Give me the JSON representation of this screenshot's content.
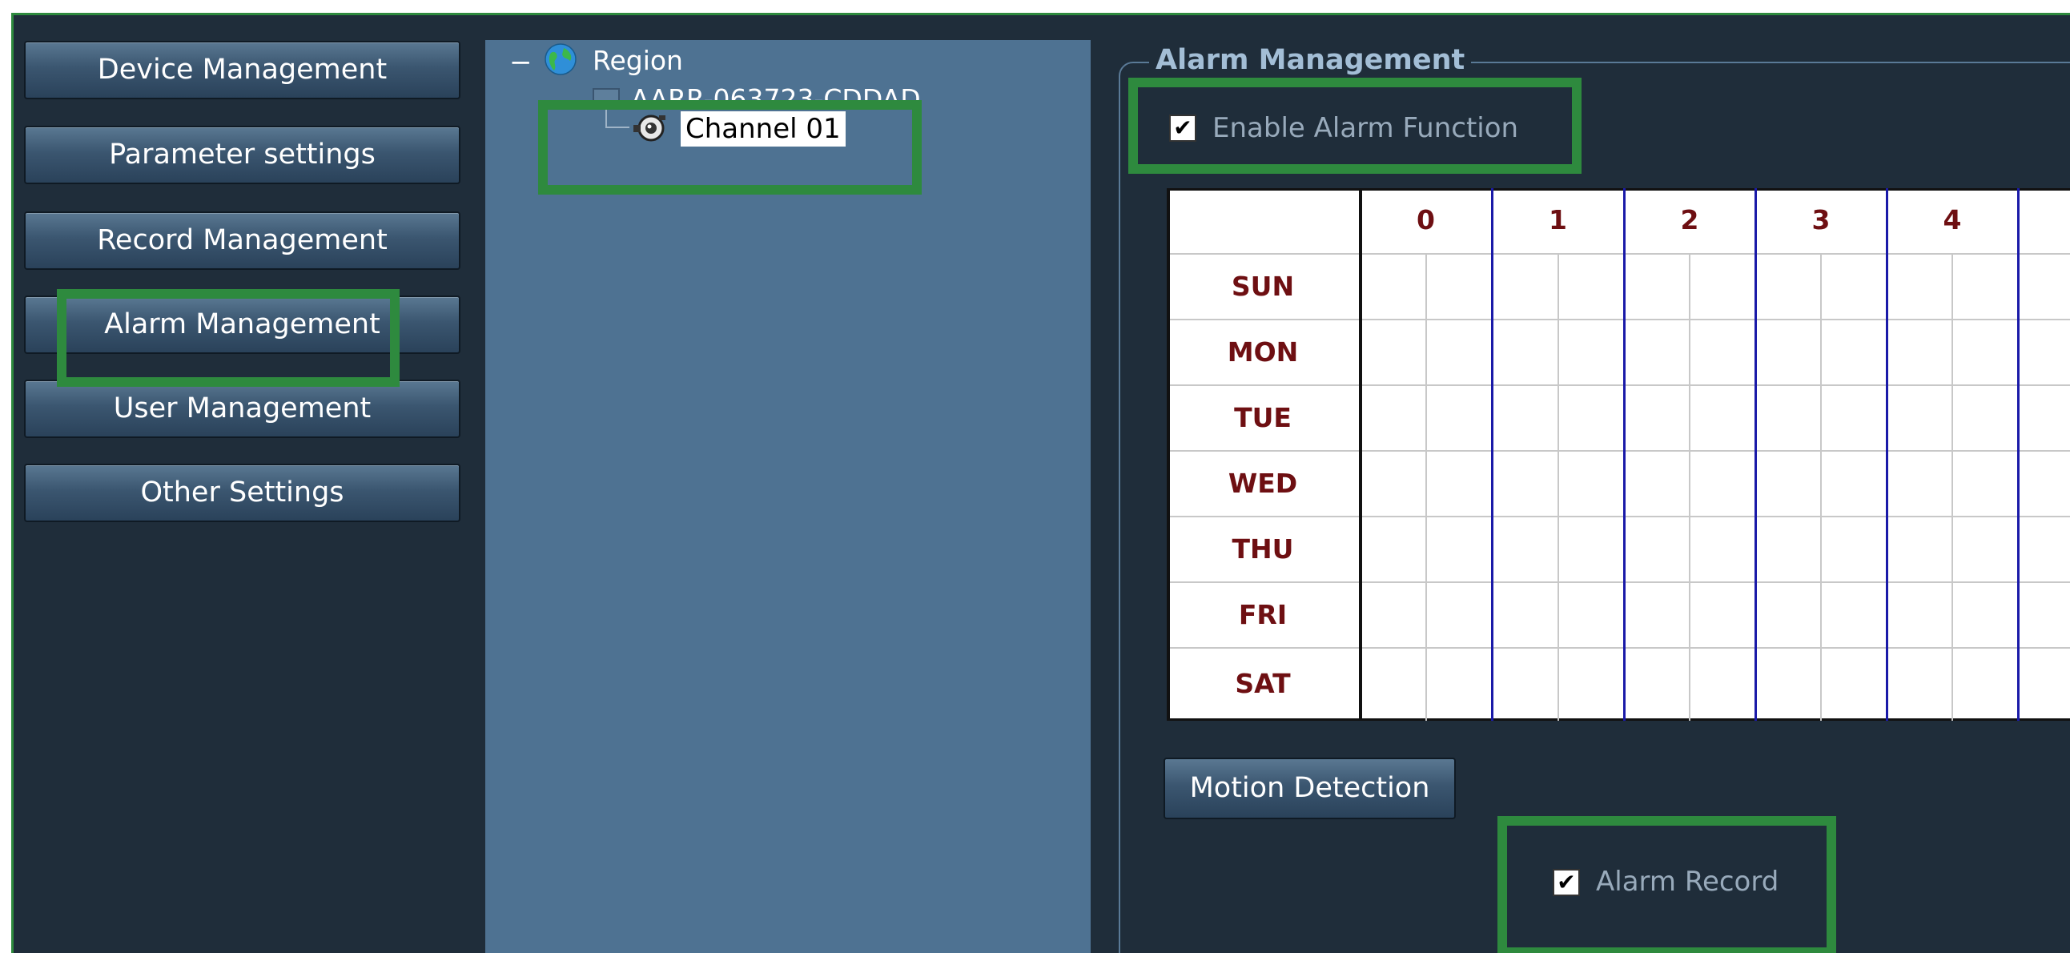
{
  "nav": {
    "items": [
      {
        "label": "Device Management"
      },
      {
        "label": "Parameter settings"
      },
      {
        "label": "Record Management"
      },
      {
        "label": "Alarm Management"
      },
      {
        "label": "User Management"
      },
      {
        "label": "Other Settings"
      }
    ]
  },
  "tree": {
    "collapse_glyph": "−",
    "root_label": "Region",
    "device_label": "AARR-063723-CDDAD",
    "channel_label": "Channel 01",
    "root_icon": "globe-icon",
    "channel_icon": "camera-icon"
  },
  "alarm": {
    "legend": "Alarm Management",
    "enable_label": "Enable Alarm Function",
    "enable_checked": true,
    "schedule": {
      "hours": [
        "0",
        "1",
        "2",
        "3",
        "4"
      ],
      "days": [
        "SUN",
        "MON",
        "TUE",
        "WED",
        "THU",
        "FRI",
        "SAT"
      ]
    },
    "motion_button": "Motion Detection",
    "record_label": "Alarm Record",
    "record_checked": true
  },
  "colors": {
    "highlight": "#2e8a3e",
    "background": "#1f2d3a",
    "tree_panel": "#4e7292",
    "day_text": "#6e0f12",
    "hour_divider": "#1a1aa8"
  }
}
